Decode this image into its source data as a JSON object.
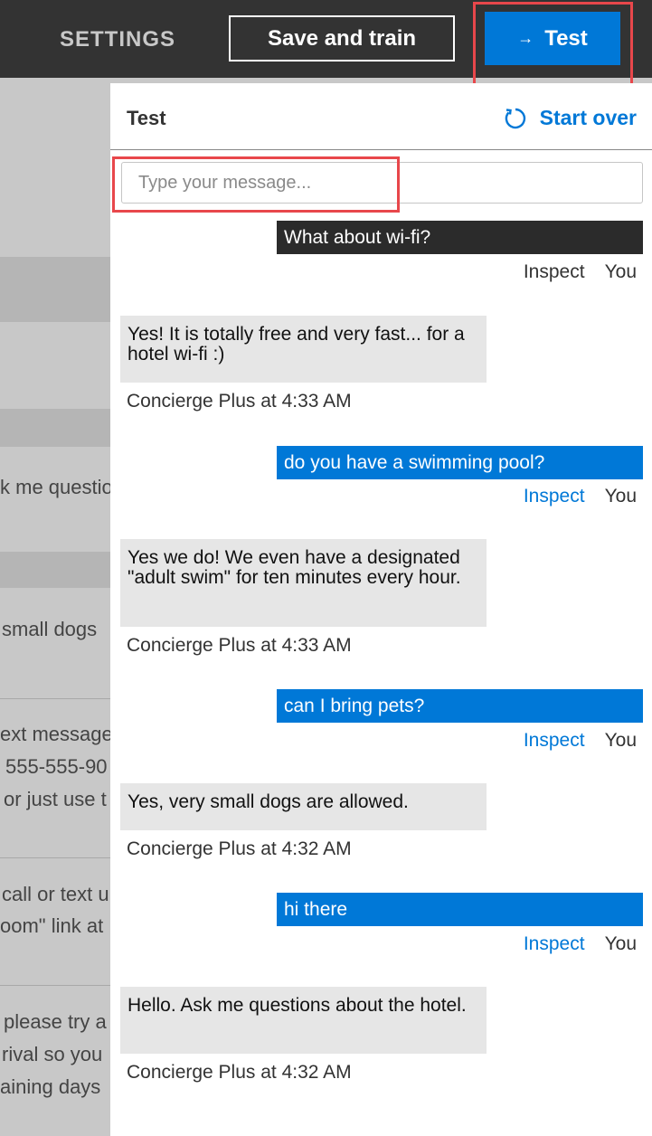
{
  "topbar": {
    "settings_label": "SETTINGS",
    "save_label": "Save and train",
    "test_label": "Test",
    "test_arrow": "→"
  },
  "background": {
    "texts": [
      "k me questio",
      "small dogs",
      "ext message",
      "555-555-90",
      "or just use t",
      "call or text u",
      "oom\" link at",
      "please try a",
      "rival so you",
      "aining days"
    ]
  },
  "panel": {
    "title": "Test",
    "start_over": "Start over",
    "input_placeholder": "Type your message...",
    "inspect_label": "Inspect",
    "you_label": "You",
    "messages": [
      {
        "user": "What about wi-fi?",
        "bot": "Yes! It is totally free and very fast... for a hotel wi-fi :)",
        "bot_meta": "Concierge Plus at 4:33 AM"
      },
      {
        "user": "do you have a swimming pool?",
        "bot": "Yes we do! We even have a designated \"adult swim\" for ten minutes every hour.",
        "bot_meta": "Concierge Plus at 4:33 AM"
      },
      {
        "user": "can I bring pets?",
        "bot": "Yes, very small dogs are allowed.",
        "bot_meta": "Concierge Plus at 4:32 AM"
      },
      {
        "user": "hi there",
        "bot": "Hello. Ask me questions about the hotel.",
        "bot_meta": "Concierge Plus at 4:32 AM"
      }
    ]
  },
  "colors": {
    "accent": "#0078d7",
    "highlight": "#e8474b",
    "topbar": "#333333"
  }
}
